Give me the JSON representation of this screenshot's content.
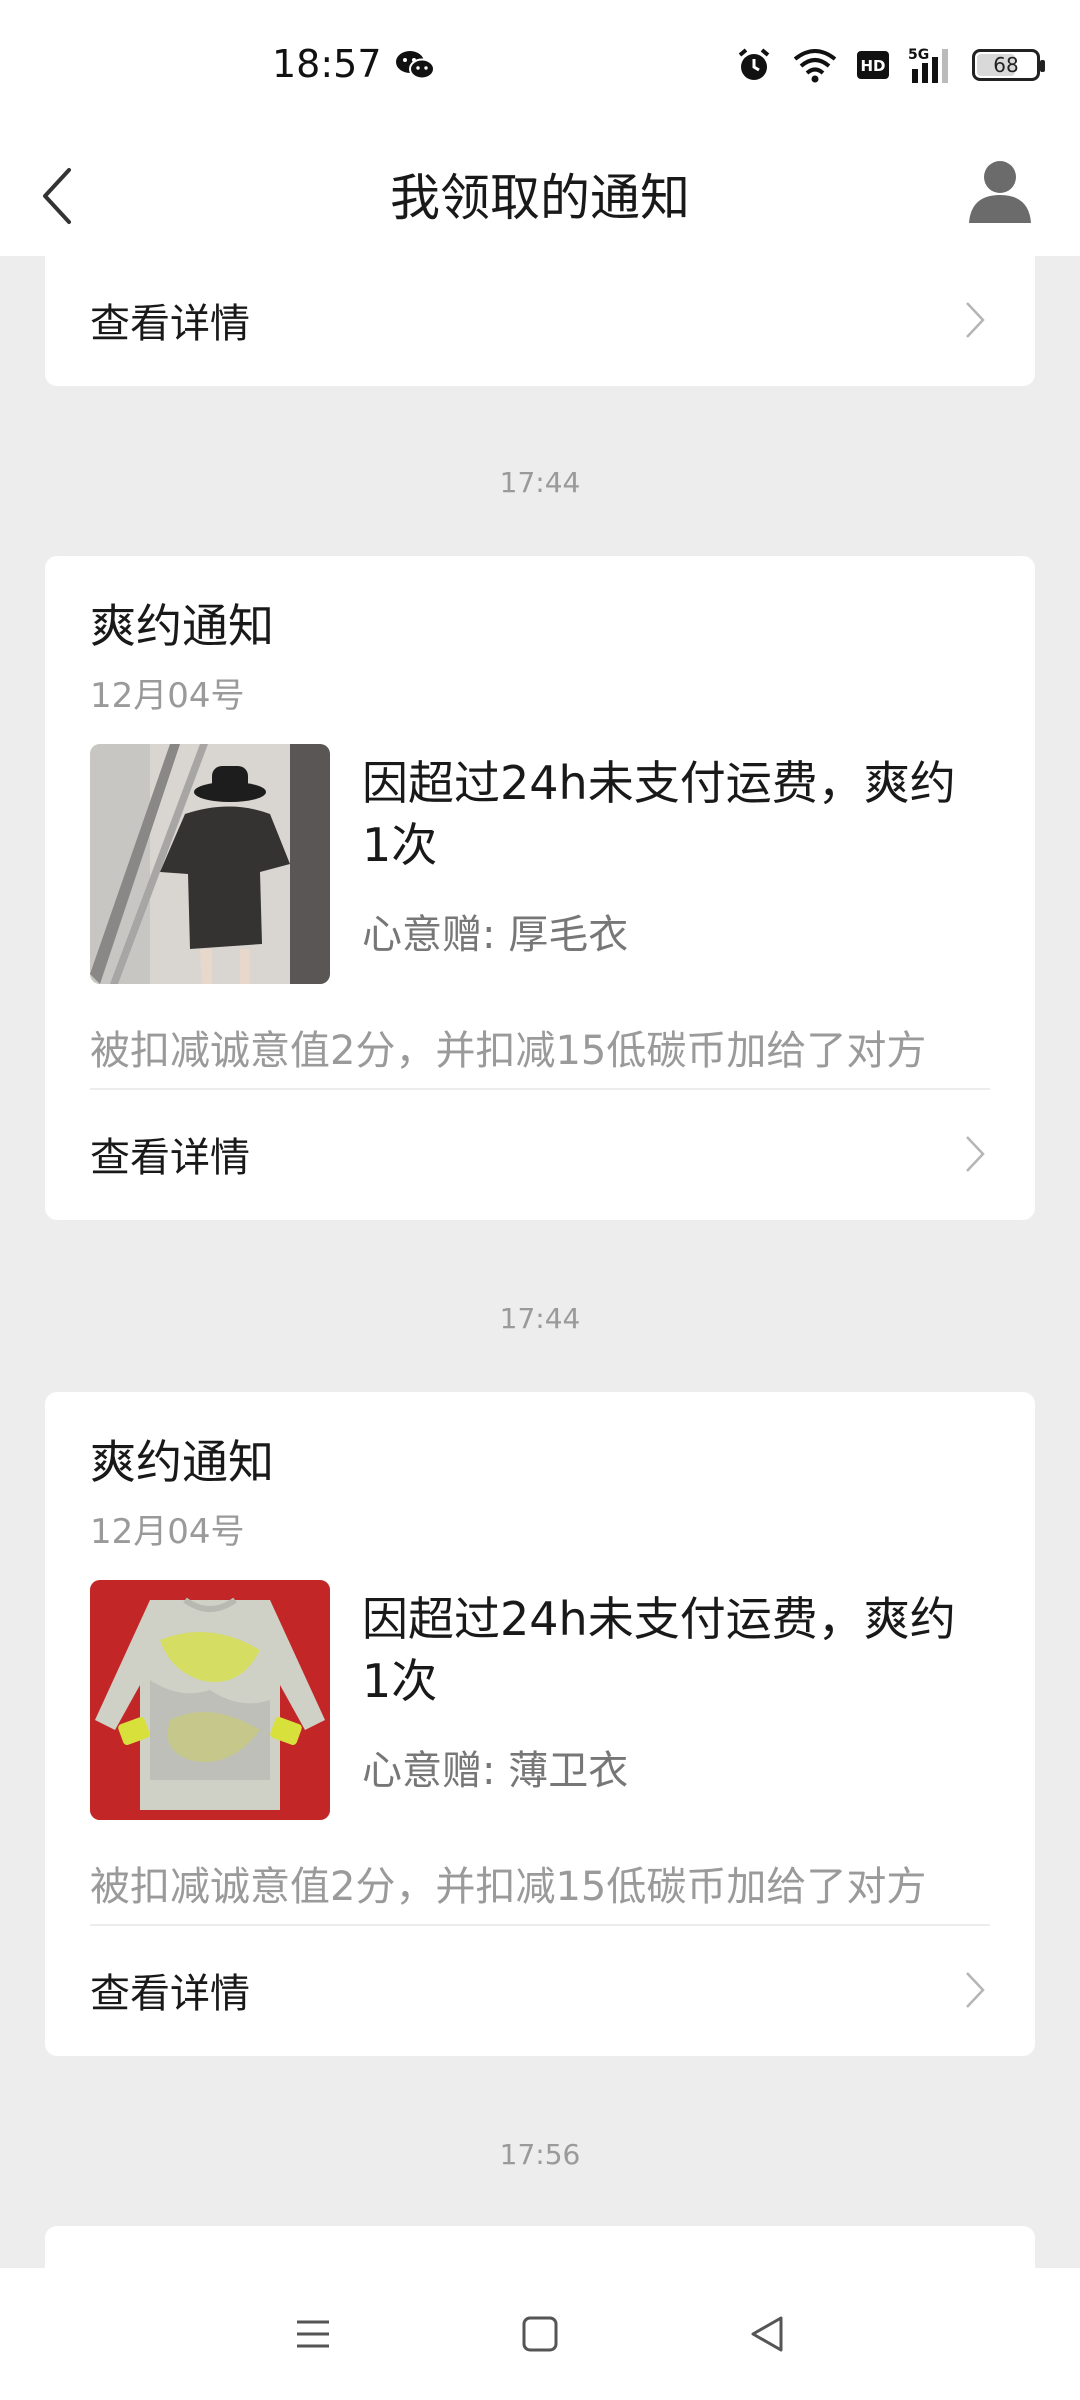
{
  "status_bar": {
    "time": "18:57",
    "battery": "68",
    "icons": [
      "wechat-icon",
      "alarm-icon",
      "wifi-icon",
      "hd-icon",
      "5g-signal-icon",
      "battery-icon"
    ]
  },
  "nav": {
    "title": "我领取的通知",
    "back_icon": "chevron-left-icon",
    "avatar_icon": "user-avatar-icon"
  },
  "partial_card": {
    "detail_label": "查看详情"
  },
  "notifications": [
    {
      "timestamp": "17:44",
      "title": "爽约通知",
      "date": "12月04号",
      "message": "因超过24h未支付运费，爽约1次",
      "gift": "心意赠: 厚毛衣",
      "description": "被扣减诚意值2分，并扣减15低碳币加给了对方",
      "detail_label": "查看详情"
    },
    {
      "timestamp": "17:44",
      "title": "爽约通知",
      "date": "12月04号",
      "message": "因超过24h未支付运费，爽约1次",
      "gift": "心意赠: 薄卫衣",
      "description": "被扣减诚意值2分，并扣减15低碳币加给了对方",
      "detail_label": "查看详情"
    }
  ],
  "next_timestamp": "17:56",
  "system_nav": [
    "menu-icon",
    "home-icon",
    "back-triangle-icon"
  ]
}
